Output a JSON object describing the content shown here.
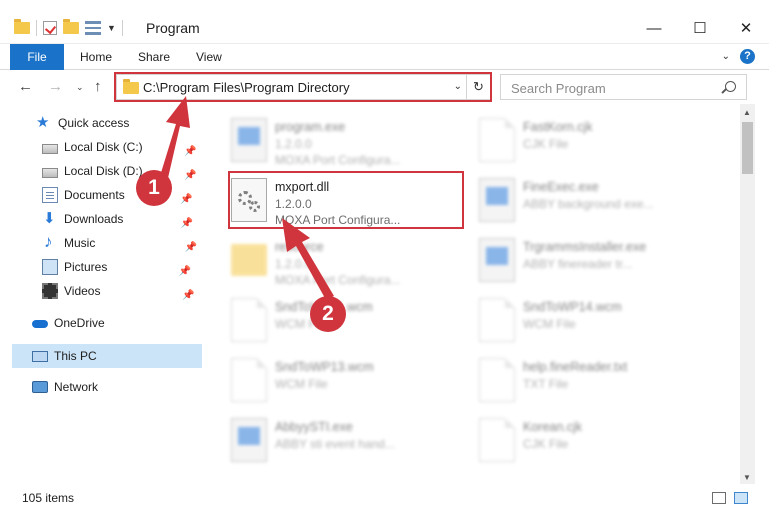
{
  "window": {
    "title": "Program",
    "minimize": "—",
    "maximize": "☐",
    "close": "✕"
  },
  "ribbon": {
    "tabs": [
      "File",
      "Home",
      "Share",
      "View"
    ],
    "collapse": "⌄",
    "help": "?"
  },
  "address": {
    "back": "←",
    "forward": "→",
    "recent": "⌄",
    "up": "↑",
    "path": "C:\\Program Files\\Program Directory",
    "dropdown": "⌄",
    "refresh": "↻",
    "search_placeholder": "Search Program"
  },
  "sidebar": {
    "items": [
      {
        "label": "Quick access",
        "icon": "star-icon",
        "pin": ""
      },
      {
        "label": "Local Disk (C:)",
        "icon": "drive-icon",
        "pin": "📌"
      },
      {
        "label": "Local Disk (D:)",
        "icon": "drive-icon",
        "pin": "📌"
      },
      {
        "label": "Documents",
        "icon": "documents-icon",
        "pin": "📌"
      },
      {
        "label": "Downloads",
        "icon": "downloads-icon",
        "pin": "📌"
      },
      {
        "label": "Music",
        "icon": "music-icon",
        "pin": "📌"
      },
      {
        "label": "Pictures",
        "icon": "pictures-icon",
        "pin": "📌"
      },
      {
        "label": "Videos",
        "icon": "videos-icon",
        "pin": "📌"
      },
      {
        "label": "OneDrive",
        "icon": "onedrive-icon",
        "pin": ""
      },
      {
        "label": "This PC",
        "icon": "this-pc-icon",
        "pin": ""
      },
      {
        "label": "Network",
        "icon": "network-icon",
        "pin": ""
      }
    ]
  },
  "files": {
    "highlighted": {
      "name": "mxport.dll",
      "version": "1.2.0.0",
      "description": "MOXA Port Configura..."
    },
    "left": [
      {
        "name": "program.exe",
        "line1": "1.2.0.0",
        "line2": "MOXA Port Configura..."
      },
      {
        "name": "resource",
        "line1": "1.2.0.0",
        "line2": "MOXA Port Configura..."
      },
      {
        "name": "SndToWP11.wcm",
        "line1": "WCM File",
        "line2": ""
      },
      {
        "name": "SndToWP13.wcm",
        "line1": "WCM File",
        "line2": ""
      },
      {
        "name": "AbbyySTI.exe",
        "line1": "ABBY sti event hand...",
        "line2": ""
      }
    ],
    "right": [
      {
        "name": "FastKorn.cjk",
        "line1": "CJK File",
        "line2": ""
      },
      {
        "name": "FineExec.exe",
        "line1": "ABBY background exe...",
        "line2": ""
      },
      {
        "name": "TrgrammsInstaller.exe",
        "line1": "ABBY finereader tr...",
        "line2": ""
      },
      {
        "name": "SndToWP14.wcm",
        "line1": "WCM File",
        "line2": ""
      },
      {
        "name": "help.fineReader.txt",
        "line1": "TXT File",
        "line2": ""
      },
      {
        "name": "Korean.cjk",
        "line1": "CJK File",
        "line2": ""
      }
    ]
  },
  "status": {
    "item_count": "105 items"
  },
  "callouts": {
    "one": "1",
    "two": "2"
  },
  "colors": {
    "accent": "#1a73c8",
    "highlight": "#d0343c",
    "selection": "#cce4f7"
  }
}
